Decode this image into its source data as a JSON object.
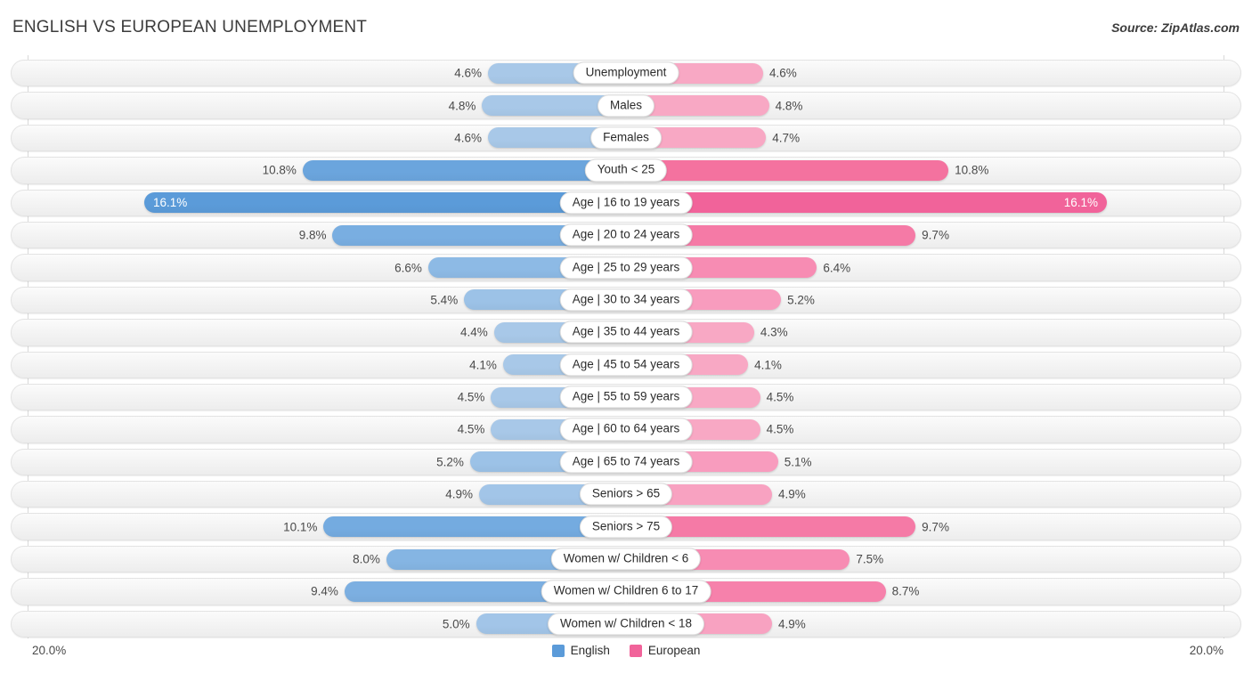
{
  "header": {
    "title": "ENGLISH VS EUROPEAN UNEMPLOYMENT",
    "source": "Source: ZipAtlas.com"
  },
  "footer": {
    "axis_min_label": "20.0%",
    "axis_max_label": "20.0%",
    "legend": [
      {
        "label": "English",
        "color": "#5b9bd9"
      },
      {
        "label": "European",
        "color": "#f1639a"
      }
    ]
  },
  "colors": {
    "english_light": "#a8c8e8",
    "english_mid": "#8bb8e2",
    "english_dark": "#5b9bd9",
    "european_light": "#f8a8c4",
    "european_mid": "#f78cb3",
    "european_dark": "#f1639a",
    "track": "#f3f3f3",
    "text": "#4a4a4a"
  },
  "chart_data": {
    "type": "bar",
    "subtype": "diverging-bar",
    "title": "ENGLISH VS EUROPEAN UNEMPLOYMENT",
    "xlabel": "",
    "ylabel": "",
    "axis_max": 20.0,
    "axis_min": 0.0,
    "unit": "%",
    "grid": false,
    "legend_position": "bottom-center",
    "series": [
      {
        "name": "English",
        "color": "#5b9bd9",
        "values": [
          4.6,
          4.8,
          4.6,
          10.8,
          16.1,
          9.8,
          6.6,
          5.4,
          4.4,
          4.1,
          4.5,
          4.5,
          5.2,
          4.9,
          10.1,
          8.0,
          9.4,
          5.0
        ]
      },
      {
        "name": "European",
        "color": "#f1639a",
        "values": [
          4.6,
          4.8,
          4.7,
          10.8,
          16.1,
          9.7,
          6.4,
          5.2,
          4.3,
          4.1,
          4.5,
          4.5,
          5.1,
          4.9,
          9.7,
          7.5,
          8.7,
          4.9
        ]
      }
    ],
    "categories": [
      "Unemployment",
      "Males",
      "Females",
      "Youth < 25",
      "Age | 16 to 19 years",
      "Age | 20 to 24 years",
      "Age | 25 to 29 years",
      "Age | 30 to 34 years",
      "Age | 35 to 44 years",
      "Age | 45 to 54 years",
      "Age | 55 to 59 years",
      "Age | 60 to 64 years",
      "Age | 65 to 74 years",
      "Seniors > 65",
      "Seniors > 75",
      "Women w/ Children < 6",
      "Women w/ Children 6 to 17",
      "Women w/ Children < 18"
    ]
  },
  "rows": [
    {
      "label": "Unemployment",
      "left_value": 4.6,
      "left_text": "4.6%",
      "right_value": 4.6,
      "right_text": "4.6%",
      "left_color": "#a8c8e8",
      "right_color": "#f8a8c4",
      "inside": false
    },
    {
      "label": "Males",
      "left_value": 4.8,
      "left_text": "4.8%",
      "right_value": 4.8,
      "right_text": "4.8%",
      "left_color": "#a8c8e8",
      "right_color": "#f8a8c4",
      "inside": false
    },
    {
      "label": "Females",
      "left_value": 4.6,
      "left_text": "4.6%",
      "right_value": 4.7,
      "right_text": "4.7%",
      "left_color": "#a8c8e8",
      "right_color": "#f8a8c4",
      "inside": false
    },
    {
      "label": "Youth < 25",
      "left_value": 10.8,
      "left_text": "10.8%",
      "right_value": 10.8,
      "right_text": "10.8%",
      "left_color": "#6ba5dd",
      "right_color": "#f4729f",
      "inside": false
    },
    {
      "label": "Age | 16 to 19 years",
      "left_value": 16.1,
      "left_text": "16.1%",
      "right_value": 16.1,
      "right_text": "16.1%",
      "left_color": "#5b9bd9",
      "right_color": "#f1639a",
      "inside": true
    },
    {
      "label": "Age | 20 to 24 years",
      "left_value": 9.8,
      "left_text": "9.8%",
      "right_value": 9.7,
      "right_text": "9.7%",
      "left_color": "#79aee1",
      "right_color": "#f57aa6",
      "inside": false
    },
    {
      "label": "Age | 25 to 29 years",
      "left_value": 6.6,
      "left_text": "6.6%",
      "right_value": 6.4,
      "right_text": "6.4%",
      "left_color": "#8dbae5",
      "right_color": "#f78cb3",
      "inside": false
    },
    {
      "label": "Age | 30 to 34 years",
      "left_value": 5.4,
      "left_text": "5.4%",
      "right_value": 5.2,
      "right_text": "5.2%",
      "left_color": "#9cc2e7",
      "right_color": "#f89cbe",
      "inside": false
    },
    {
      "label": "Age | 35 to 44 years",
      "left_value": 4.4,
      "left_text": "4.4%",
      "right_value": 4.3,
      "right_text": "4.3%",
      "left_color": "#a8c8e8",
      "right_color": "#f8a8c4",
      "inside": false
    },
    {
      "label": "Age | 45 to 54 years",
      "left_value": 4.1,
      "left_text": "4.1%",
      "right_value": 4.1,
      "right_text": "4.1%",
      "left_color": "#a8c8e8",
      "right_color": "#f8a8c4",
      "inside": false
    },
    {
      "label": "Age | 55 to 59 years",
      "left_value": 4.5,
      "left_text": "4.5%",
      "right_value": 4.5,
      "right_text": "4.5%",
      "left_color": "#a8c8e8",
      "right_color": "#f8a8c4",
      "inside": false
    },
    {
      "label": "Age | 60 to 64 years",
      "left_value": 4.5,
      "left_text": "4.5%",
      "right_value": 4.5,
      "right_text": "4.5%",
      "left_color": "#a8c8e8",
      "right_color": "#f8a8c4",
      "inside": false
    },
    {
      "label": "Age | 65 to 74 years",
      "left_value": 5.2,
      "left_text": "5.2%",
      "right_value": 5.1,
      "right_text": "5.1%",
      "left_color": "#9cc2e7",
      "right_color": "#f89cbe",
      "inside": false
    },
    {
      "label": "Seniors > 65",
      "left_value": 4.9,
      "left_text": "4.9%",
      "right_value": 4.9,
      "right_text": "4.9%",
      "left_color": "#a2c5e8",
      "right_color": "#f8a2c1",
      "inside": false
    },
    {
      "label": "Seniors > 75",
      "left_value": 10.1,
      "left_text": "10.1%",
      "right_value": 9.7,
      "right_text": "9.7%",
      "left_color": "#74abe0",
      "right_color": "#f57aa6",
      "inside": false
    },
    {
      "label": "Women w/ Children < 6",
      "left_value": 8.0,
      "left_text": "8.0%",
      "right_value": 7.5,
      "right_text": "7.5%",
      "left_color": "#85b5e3",
      "right_color": "#f78cb3",
      "inside": false
    },
    {
      "label": "Women w/ Children 6 to 17",
      "left_value": 9.4,
      "left_text": "9.4%",
      "right_value": 8.7,
      "right_text": "8.7%",
      "left_color": "#7cafe1",
      "right_color": "#f681ab",
      "inside": false
    },
    {
      "label": "Women w/ Children < 18",
      "left_value": 5.0,
      "left_text": "5.0%",
      "right_value": 4.9,
      "right_text": "4.9%",
      "left_color": "#a2c5e8",
      "right_color": "#f8a2c1",
      "inside": false
    }
  ]
}
